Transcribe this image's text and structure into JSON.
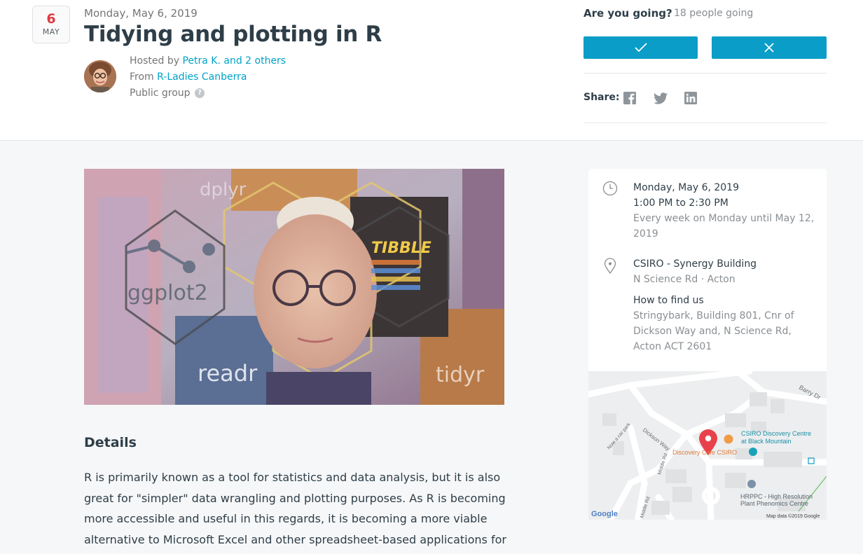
{
  "event": {
    "badge_day": "6",
    "badge_month": "MAY",
    "date": "Monday, May 6, 2019",
    "title": "Tidying and plotting in R",
    "hosted_prefix": "Hosted by",
    "hosted_by": "Petra K. and 2 others",
    "from_prefix": "From",
    "group": "R-Ladies Canberra",
    "visibility": "Public group",
    "help_glyph": "?"
  },
  "rsvp": {
    "question": "Are you going?",
    "count": "18 people going",
    "yes_icon": "check-icon",
    "no_icon": "close-icon"
  },
  "share": {
    "label": "Share:",
    "icons": [
      "facebook-icon",
      "twitter-icon",
      "linkedin-icon"
    ]
  },
  "hero_image": {
    "labels": [
      "dplyr",
      "ggplot2",
      "TIBBLE",
      "readr",
      "tidyr"
    ]
  },
  "details": {
    "heading": "Details",
    "body": "R is primarily known as a tool for statistics and data analysis, but it is also great for \"simpler\" data wrangling and plotting purposes. As R is becoming more accessible and useful in this regards, it is becoming a more viable alternative to Microsoft Excel and other spreadsheet-based applications for wrangling,"
  },
  "info_card": {
    "date": "Monday, May 6, 2019",
    "time": "1:00 PM to 2:30 PM",
    "recurrence": "Every week on Monday until May 12, 2019",
    "venue": "CSIRO - Synergy Building",
    "address": "N Science Rd · Acton",
    "how_to_find_label": "How to find us",
    "how_to_find": "Stringybark, Building 801, Cnr of Dickson Way and, N Science Rd, Acton ACT 2601"
  },
  "map": {
    "labels": {
      "barry": "Barry Dr",
      "dickson": "Dickson Way",
      "carpark": "Now a car park",
      "middle1": "Middle Rd",
      "middle2": "Middle Rd",
      "cafe": "Discovery Cafe CSIRO",
      "centre1": "CSIRO Discovery Centre",
      "centre2": "at Black Mountain",
      "hrppc1": "HRPPC - High Resolution",
      "hrppc2": "Plant Phenomics Centre",
      "google": "Google",
      "mapdata": "Map data ©2019 Google"
    }
  },
  "colors": {
    "accent": "#0a9dc7",
    "link": "#00a2c7",
    "date_red": "#e0393e",
    "text": "#2e3e48",
    "muted": "#8a8f93"
  }
}
